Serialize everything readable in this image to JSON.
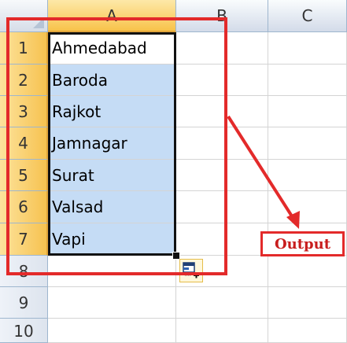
{
  "columns": [
    "A",
    "B",
    "C"
  ],
  "rows": [
    "1",
    "2",
    "3",
    "4",
    "5",
    "6",
    "7",
    "8",
    "9",
    "10"
  ],
  "cells": {
    "A1": "Ahmedabad",
    "A2": "Baroda",
    "A3": "Rajkot",
    "A4": "Jamnagar",
    "A5": "Surat",
    "A6": "Valsad",
    "A7": "Vapi"
  },
  "annotation": {
    "label": "Output",
    "color": "#e32a2a"
  },
  "colors": {
    "selection_fill": "#c5dcf5",
    "header_selected": "#f8c34a",
    "gridline": "#d4d4d4"
  },
  "icons": {
    "autofill": "auto-fill-options-icon"
  }
}
